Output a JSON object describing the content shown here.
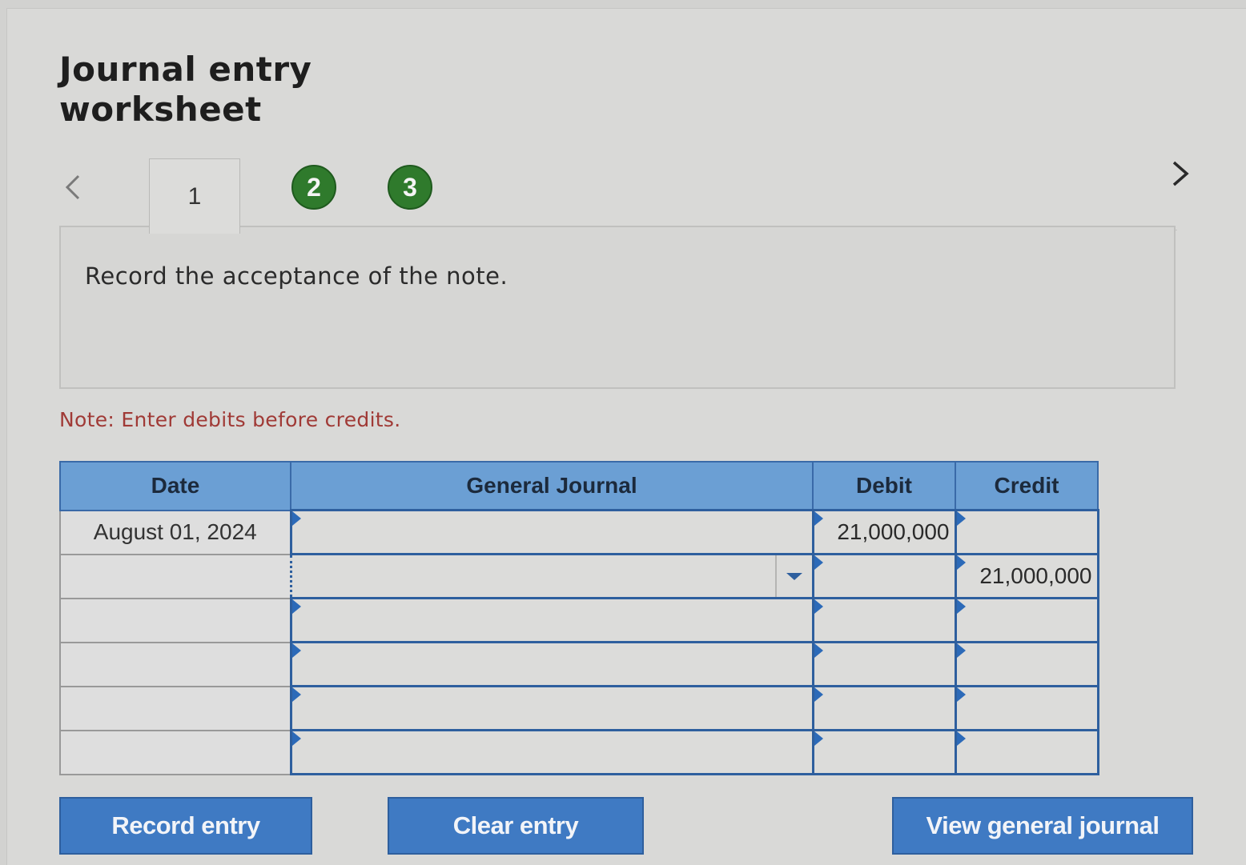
{
  "header": {
    "title_line1": "Journal entry",
    "title_line2": "worksheet"
  },
  "navigation": {
    "prev_icon": "chevron-left-icon",
    "next_icon": "chevron-right-icon",
    "tabs": [
      {
        "label": "1",
        "state": "active"
      },
      {
        "label": "2",
        "state": "completed"
      },
      {
        "label": "3",
        "state": "completed"
      }
    ]
  },
  "instruction": {
    "text": "Record the acceptance of the note."
  },
  "note": {
    "text": "Note: Enter debits before credits."
  },
  "journal": {
    "headers": {
      "date": "Date",
      "account": "General Journal",
      "debit": "Debit",
      "credit": "Credit"
    },
    "rows": [
      {
        "date": "August 01, 2024",
        "account": "",
        "debit": "21,000,000",
        "credit": ""
      },
      {
        "date": "",
        "account": "",
        "debit": "",
        "credit": "21,000,000"
      },
      {
        "date": "",
        "account": "",
        "debit": "",
        "credit": ""
      },
      {
        "date": "",
        "account": "",
        "debit": "",
        "credit": ""
      },
      {
        "date": "",
        "account": "",
        "debit": "",
        "credit": ""
      },
      {
        "date": "",
        "account": "",
        "debit": "",
        "credit": ""
      }
    ]
  },
  "buttons": {
    "record_entry": "Record entry",
    "clear_entry": "Clear entry",
    "view_general_journal": "View general journal"
  },
  "colors": {
    "header_blue": "#6b9fd4",
    "button_blue": "#3f7ac3",
    "tab_green": "#2f7a2c",
    "note_red": "#a03a36"
  }
}
